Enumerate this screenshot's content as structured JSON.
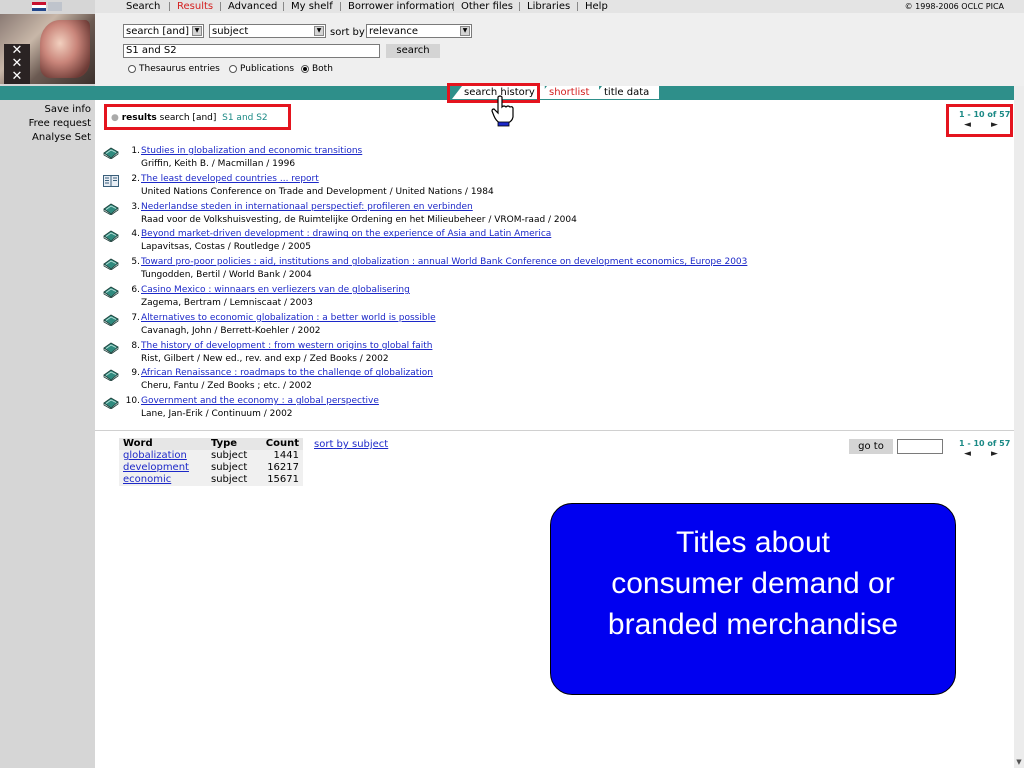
{
  "nav": {
    "items": [
      {
        "label": "Search",
        "active": false
      },
      {
        "label": "Results",
        "active": true
      },
      {
        "label": "Advanced",
        "active": false
      },
      {
        "label": "My shelf",
        "active": false
      },
      {
        "label": "Borrower information",
        "active": false
      },
      {
        "label": "Other files",
        "active": false
      },
      {
        "label": "Libraries",
        "active": false
      },
      {
        "label": "Help",
        "active": false
      }
    ],
    "copyright": "© 1998-2006 OCLC PICA"
  },
  "search": {
    "operator": "search [and]",
    "field": "subject",
    "sort_label": "sort by",
    "sort": "relevance",
    "query": "S1 and S2",
    "button": "search",
    "radios": [
      {
        "label": "Thesaurus entries",
        "checked": false
      },
      {
        "label": "Publications",
        "checked": false
      },
      {
        "label": "Both",
        "checked": true
      }
    ]
  },
  "tabs": {
    "search_history": "search history",
    "shortlist": "shortlist",
    "title_data": "title data"
  },
  "left_links": [
    "Save info",
    "Free request",
    "Analyse Set"
  ],
  "results_header": {
    "label": "results",
    "operator": "search [and]",
    "query": "S1 and S2"
  },
  "pager": {
    "range": "1 - 10 of 57",
    "prev": "◄",
    "next": "►"
  },
  "results": [
    {
      "num": "1.",
      "title": "Studies in globalization and economic transitions",
      "author": "Griffin, Keith B. / Macmillan / 1996",
      "type": "book"
    },
    {
      "num": "2.",
      "title": "The least developed countries ... report",
      "author": "United Nations Conference on Trade and Development / United Nations / 1984",
      "type": "serial"
    },
    {
      "num": "3.",
      "title": "Nederlandse steden in internationaal perspectief: profileren en verbinden",
      "author": "Raad voor de Volkshuisvesting, de Ruimtelijke Ordening en het Milieubeheer / VROM-raad / 2004",
      "type": "book"
    },
    {
      "num": "4.",
      "title": "Beyond market-driven development : drawing on the experience of Asia and Latin America",
      "author": "Lapavitsas, Costas / Routledge / 2005",
      "type": "book"
    },
    {
      "num": "5.",
      "title": "Toward pro-poor policies : aid, institutions and globalization : annual World Bank Conference on development economics, Europe 2003",
      "author": "Tungodden, Bertil / World Bank / 2004",
      "type": "book"
    },
    {
      "num": "6.",
      "title": "Casino Mexico : winnaars en verliezers van de globalisering",
      "author": "Zagema, Bertram / Lemniscaat / 2003",
      "type": "book"
    },
    {
      "num": "7.",
      "title": "Alternatives to economic globalization : a better world is possible",
      "author": "Cavanagh, John / Berrett-Koehler / 2002",
      "type": "book"
    },
    {
      "num": "8.",
      "title": "The history of development : from western origins to global faith",
      "author": "Rist, Gilbert / New ed., rev. and exp / Zed Books / 2002",
      "type": "book"
    },
    {
      "num": "9.",
      "title": "African Renaissance : roadmaps to the challenge of globalization",
      "author": "Cheru, Fantu / Zed Books ; etc. / 2002",
      "type": "book"
    },
    {
      "num": "10.",
      "title": "Government and the economy : a global perspective",
      "author": "Lane, Jan-Erik / Continuum / 2002",
      "type": "book"
    }
  ],
  "word_table": {
    "headers": [
      "Word",
      "Type",
      "Count"
    ],
    "rows": [
      {
        "word": "globalization",
        "type": "subject",
        "count": "1441"
      },
      {
        "word": "development",
        "type": "subject",
        "count": "16217"
      },
      {
        "word": "economic",
        "type": "subject",
        "count": "15671"
      }
    ],
    "sort_link": "sort by subject"
  },
  "goto": {
    "button": "go to",
    "value": ""
  },
  "callout": {
    "text": "Titles about\nconsumer demand or\nbranded merchandise"
  },
  "colors": {
    "accent_red": "#e4141e",
    "teal": "#2e8f8a",
    "link_blue": "#1c28c8",
    "callout_blue": "#0000f0"
  },
  "icons": {
    "book": "book-icon",
    "serial": "serial-icon"
  }
}
